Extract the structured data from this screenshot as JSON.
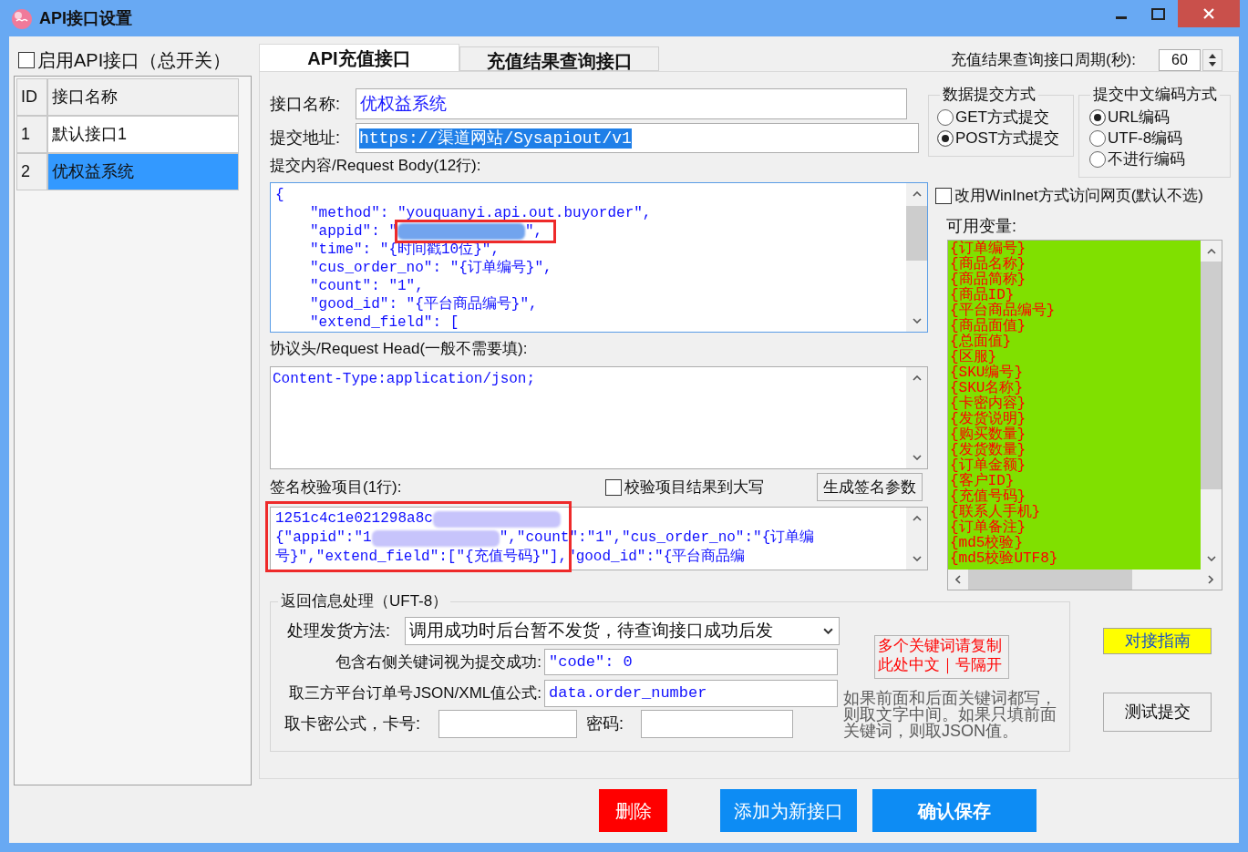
{
  "window": {
    "title": "API接口设置"
  },
  "master_switch": {
    "label": "启用API接口（总开关）",
    "checked": false
  },
  "interface_list": {
    "columns": [
      "ID",
      "接口名称"
    ],
    "rows": [
      {
        "id": "1",
        "name": "默认接口1",
        "selected": false
      },
      {
        "id": "2",
        "name": "优权益系统",
        "selected": true
      }
    ]
  },
  "tabs": [
    {
      "label": "API充值接口",
      "selected": true
    },
    {
      "label": "充值结果查询接口",
      "selected": false
    }
  ],
  "query_period": {
    "label": "充值结果查询接口周期(秒):",
    "value": "60"
  },
  "interface_name": {
    "label": "接口名称:",
    "value": "优权益系统"
  },
  "submit_url": {
    "label": "提交地址:",
    "value": "https://渠道网站/Sysapiout/v1",
    "value_selected": true
  },
  "request_body": {
    "label": "提交内容/Request Body(12行):",
    "open": "{",
    "entries": [
      {
        "kind": "text",
        "text": "\"method\": \"youquanyi.api.out.buyorder\","
      },
      {
        "kind": "redacted",
        "before": "\"appid\": \"",
        "after": "\","
      },
      {
        "kind": "text",
        "text": "\"time\": \"{时间戳10位}\","
      },
      {
        "kind": "text",
        "text": "\"cus_order_no\": \"{订单编号}\","
      },
      {
        "kind": "text",
        "text": "\"count\": \"1\","
      },
      {
        "kind": "text",
        "text": "\"good_id\": \"{平台商品编号}\","
      },
      {
        "kind": "text",
        "text": "\"extend_field\": ["
      }
    ]
  },
  "request_head": {
    "label": "协议头/Request Head(一般不需要填):",
    "value": "Content-Type:application/json;"
  },
  "signature": {
    "label": "签名校验项目(1行):",
    "uppercase": {
      "label": "校验项目结果到大写",
      "checked": false
    },
    "button": "生成签名参数",
    "lines": [
      {
        "kind": "redacted",
        "before": "1251c4c1e021298a8c"
      },
      {
        "kind": "redacted",
        "before": "{\"appid\":\"1",
        "after": "\",\"count\":\"1\",\"cus_order_no\":\"{订单编"
      },
      {
        "kind": "text",
        "text": "号}\",\"extend_field\":[\"{充值号码}\"],\"good_id\":\"{平台商品编"
      }
    ]
  },
  "submit_method": {
    "title": "数据提交方式",
    "options": [
      {
        "label": "GET方式提交",
        "selected": false
      },
      {
        "label": "POST方式提交",
        "selected": true
      }
    ]
  },
  "encoding": {
    "title": "提交中文编码方式",
    "options": [
      {
        "label": "URL编码",
        "selected": true
      },
      {
        "label": "UTF-8编码",
        "selected": false
      },
      {
        "label": "不进行编码",
        "selected": false
      }
    ]
  },
  "wininet": {
    "label": "改用WinInet方式访问网页(默认不选)",
    "checked": false
  },
  "variables": {
    "label": "可用变量:",
    "items": [
      "{订单编号}",
      "{商品名称}",
      "{商品简称}",
      "{商品ID}",
      "{平台商品编号}",
      "{商品面值}",
      "{总面值}",
      "{区服}",
      "{SKU编号}",
      "{SKU名称}",
      "{卡密内容}",
      "{发货说明}",
      "{购买数量}",
      "{发货数量}",
      "{订单金额}",
      "{客户ID}",
      "{充值号码}",
      "{联系人手机}",
      "{订单备注}",
      "{md5校验}",
      "{md5校验UTF8}"
    ]
  },
  "response": {
    "title": "返回信息处理（UFT-8）",
    "delivery": {
      "label": "处理发货方法:",
      "value": "调用成功时后台暂不发货，待查询接口成功后发"
    },
    "success_keyword": {
      "label": "包含右侧关键词视为提交成功:",
      "value": "\"code\": 0"
    },
    "order_formula": {
      "label": "取三方平台订单号JSON/XML值公式:",
      "value": "data.order_number"
    },
    "card_formula": {
      "label": "取卡密公式，卡号:"
    },
    "password": {
      "label": "密码:"
    },
    "keyword_note": "多个关键词请复制此处中文｜号隔开",
    "hint": "如果前面和后面关键词都写，则取文字中间。如果只填前面关键词，则取JSON值。"
  },
  "side_buttons": [
    {
      "label": "对接指南",
      "kind": "highlight"
    },
    {
      "label": "测试提交",
      "kind": "plain"
    }
  ],
  "actions": [
    {
      "label": "删除",
      "kind": "danger"
    },
    {
      "label": "添加为新接口",
      "kind": "primary"
    },
    {
      "label": "确认保存",
      "kind": "emphasis"
    }
  ]
}
